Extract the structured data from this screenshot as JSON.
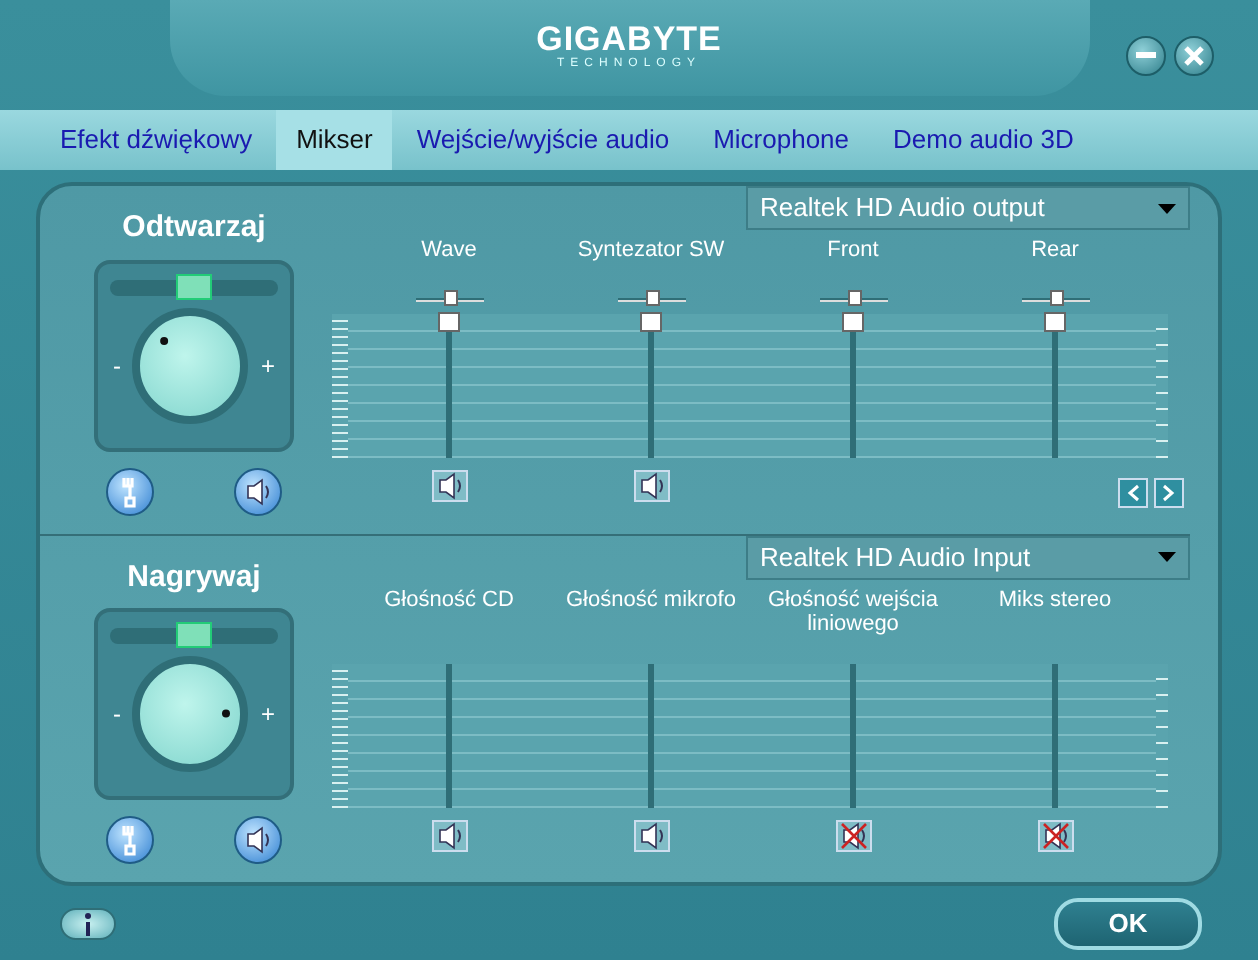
{
  "window": {
    "logo": "GIGABYTE",
    "logo_sub": "TECHNOLOGY"
  },
  "tabs": [
    {
      "label": "Efekt dźwiękowy",
      "selected": false
    },
    {
      "label": "Mikser",
      "selected": true
    },
    {
      "label": "Wejście/wyjście audio",
      "selected": false
    },
    {
      "label": "Microphone",
      "selected": false
    },
    {
      "label": "Demo audio 3D",
      "selected": false
    }
  ],
  "sections": [
    {
      "title": "Odtwarzaj",
      "balance": {
        "level": 0.5
      },
      "knob": {
        "level": 0.33,
        "min_label": "-",
        "max_label": "+"
      },
      "device": "Realtek HD Audio output",
      "pager": true,
      "channels": [
        {
          "name": "Wave",
          "balance": {
            "level": 0.5
          },
          "fader": {
            "level": 1
          },
          "muted": false
        },
        {
          "name": "Syntezator SW",
          "balance": {
            "level": 0.5
          },
          "fader": {
            "level": 1
          },
          "muted": false
        },
        {
          "name": "Front",
          "balance": {
            "level": 0.5
          },
          "fader": {
            "level": 1
          }
        },
        {
          "name": "Rear",
          "balance": {
            "level": 0.5
          },
          "fader": {
            "level": 1
          }
        }
      ]
    },
    {
      "title": "Nagrywaj",
      "balance": {
        "level": 0.5
      },
      "knob": {
        "level": 0.83,
        "min_label": "-",
        "max_label": "+"
      },
      "device": "Realtek HD Audio Input",
      "pager": false,
      "channels": [
        {
          "name": "Głośność CD",
          "muted": false
        },
        {
          "name": "Głośność mikrofo",
          "muted": false
        },
        {
          "name": "Głośność wejścia liniowego",
          "muted": true
        },
        {
          "name": "Miks stereo",
          "muted": true
        }
      ]
    }
  ],
  "footer": {
    "ok": "OK"
  }
}
